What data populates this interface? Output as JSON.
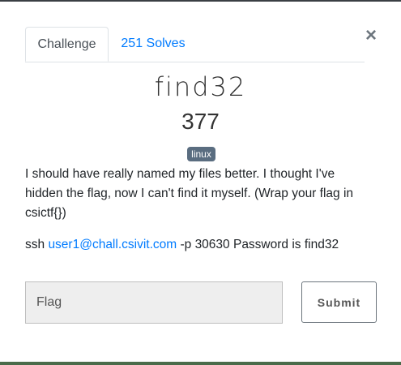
{
  "tabs": [
    {
      "label": "Challenge"
    },
    {
      "label": "251 Solves"
    }
  ],
  "close_label": "×",
  "challenge": {
    "name": "find32",
    "points": "377",
    "tag": "linux",
    "description": "I should have really named my files better. I thought I've hidden the flag, now I can't find it myself. (Wrap your flag in csictf{})",
    "connection": {
      "prefix": "ssh ",
      "email": "user1@chall.csivit.com",
      "suffix": " -p 30630 Password is find32"
    }
  },
  "form": {
    "flag_placeholder": "Flag",
    "submit_label": "Submit"
  }
}
